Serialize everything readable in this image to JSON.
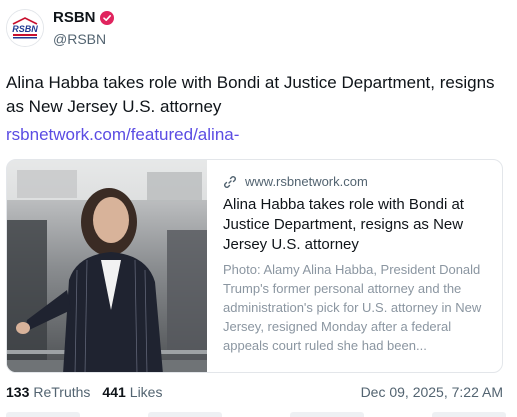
{
  "author": {
    "display_name": "RSBN",
    "handle": "@RSBN",
    "verified_color": "#e0245e",
    "avatar_logo_text": "RSBN"
  },
  "post": {
    "text": "Alina Habba takes role with Bondi at Justice Department, resigns as New Jersey U.S. attorney",
    "link": "rsbnetwork.com/featured/alina-"
  },
  "card": {
    "domain": "www.rsbnetwork.com",
    "title": "Alina Habba takes role with Bondi at Justice Department, resigns as New Jersey U.S. attorney",
    "description": "Photo: Alamy Alina Habba, President Donald Trump's former personal attorney and the administration's pick for U.S. attorney in New Jersey, resigned Monday after a federal appeals court ruled she had been..."
  },
  "stats": {
    "retruths_count": "133",
    "retruths_label": "ReTruths",
    "likes_count": "441",
    "likes_label": "Likes",
    "timestamp": "Dec 09, 2025, 7:22 AM"
  },
  "colors": {
    "link": "#5b4ce3",
    "text_primary": "#0f1419",
    "text_secondary": "#536471"
  }
}
